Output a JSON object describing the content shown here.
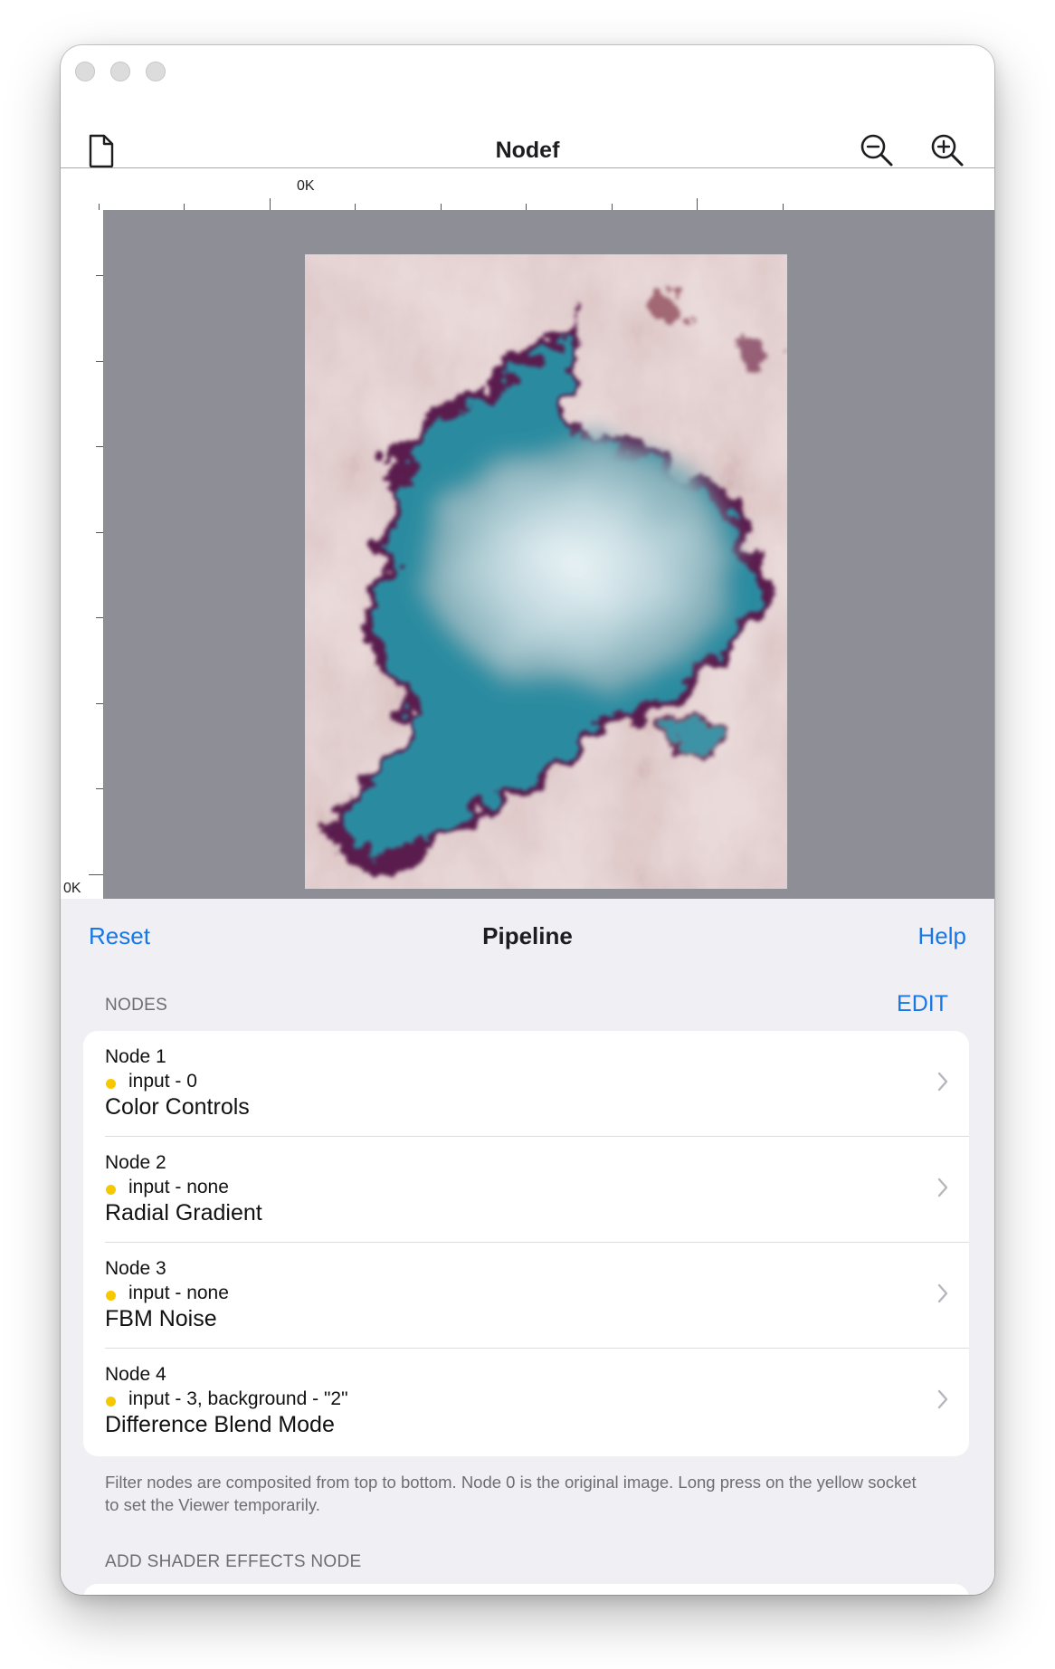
{
  "window": {
    "title": "Nodef"
  },
  "toolbar": {
    "left_icon": "document-icon",
    "right_icons": [
      "zoom-out-icon",
      "zoom-in-icon"
    ]
  },
  "ruler": {
    "horizontal_label": "0K",
    "vertical_label": "0K"
  },
  "preview": {
    "image": "rendered filter output — cloudy fbm noise with teal/purple difference blend"
  },
  "pipeline": {
    "reset_label": "Reset",
    "title": "Pipeline",
    "help_label": "Help",
    "nodes_header": "NODES",
    "edit_label": "EDIT",
    "nodes": [
      {
        "name": "Node 1",
        "input": "input - 0",
        "filter": "Color Controls"
      },
      {
        "name": "Node 2",
        "input": "input - none",
        "filter": "Radial Gradient"
      },
      {
        "name": "Node 3",
        "input": "input - none",
        "filter": "FBM Noise"
      },
      {
        "name": "Node 4",
        "input": "input - 3, background - \"2\"",
        "filter": "Difference Blend Mode"
      }
    ],
    "footer": "Filter nodes are composited from top to bottom. Node 0 is the original image. Long press on the yellow socket to set the Viewer temporarily.",
    "add_header": "ADD SHADER EFFECTS NODE"
  },
  "colors": {
    "accent": "#1877e6",
    "socket": "#f5c800",
    "canvas_bg": "#8e8e96",
    "panel_bg": "#efeff4"
  }
}
